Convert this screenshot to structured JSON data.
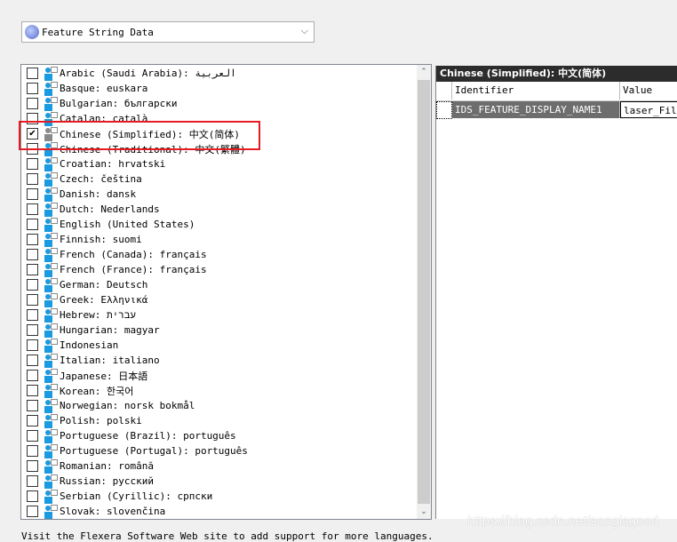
{
  "dropdown": {
    "value": "Feature String Data",
    "icon": "database-icon"
  },
  "languages": [
    {
      "label": "Arabic (Saudi Arabia): العربية",
      "checked": false
    },
    {
      "label": "Basque: euskara",
      "checked": false
    },
    {
      "label": "Bulgarian: български",
      "checked": false
    },
    {
      "label": "Catalan: català",
      "checked": false
    },
    {
      "label": "Chinese (Simplified): 中文(简体)",
      "checked": true
    },
    {
      "label": "Chinese (Traditional): 中文(繁體)",
      "checked": false
    },
    {
      "label": "Croatian: hrvatski",
      "checked": false
    },
    {
      "label": "Czech: čeština",
      "checked": false
    },
    {
      "label": "Danish: dansk",
      "checked": false
    },
    {
      "label": "Dutch: Nederlands",
      "checked": false
    },
    {
      "label": "English (United States)",
      "checked": false
    },
    {
      "label": "Finnish: suomi",
      "checked": false
    },
    {
      "label": "French (Canada): français",
      "checked": false
    },
    {
      "label": "French (France): français",
      "checked": false
    },
    {
      "label": "German: Deutsch",
      "checked": false
    },
    {
      "label": "Greek: Ελληνικά",
      "checked": false
    },
    {
      "label": "Hebrew: עברית",
      "checked": false
    },
    {
      "label": "Hungarian: magyar",
      "checked": false
    },
    {
      "label": "Indonesian",
      "checked": false
    },
    {
      "label": "Italian: italiano",
      "checked": false
    },
    {
      "label": "Japanese: 日本語",
      "checked": false
    },
    {
      "label": "Korean: 한국어",
      "checked": false
    },
    {
      "label": "Norwegian: norsk bokmål",
      "checked": false
    },
    {
      "label": "Polish: polski",
      "checked": false
    },
    {
      "label": "Portuguese (Brazil): português",
      "checked": false
    },
    {
      "label": "Portuguese (Portugal): português",
      "checked": false
    },
    {
      "label": "Romanian: română",
      "checked": false
    },
    {
      "label": "Russian: русский",
      "checked": false
    },
    {
      "label": "Serbian (Cyrillic): српски",
      "checked": false
    },
    {
      "label": "Slovak: slovenčina",
      "checked": false
    }
  ],
  "right": {
    "title": "Chinese (Simplified): 中文(简体)",
    "columns": [
      "Identifier",
      "Value"
    ],
    "rows": [
      {
        "identifier": "IDS_FEATURE_DISPLAY_NAME1",
        "value": "laser_Files"
      }
    ]
  },
  "footer": "Visit the Flexera Software Web site to add support for more languages.",
  "watermark": "https://blog.csdn.net/songisgood"
}
